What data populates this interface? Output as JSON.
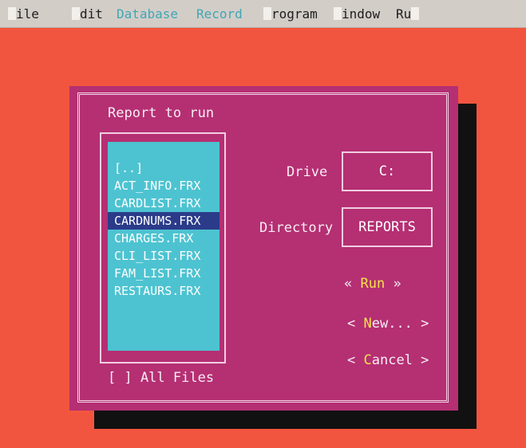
{
  "menubar": {
    "items": [
      {
        "label": "ile",
        "dim": false
      },
      {
        "label": "dit",
        "dim": false
      },
      {
        "label": "Database",
        "dim": true
      },
      {
        "label": "Record",
        "dim": true
      },
      {
        "label": "rogram",
        "dim": false
      },
      {
        "label": "indow",
        "dim": false
      },
      {
        "label": "Ru",
        "dim": false
      }
    ]
  },
  "dialog": {
    "title": "Report to run",
    "files": [
      "[..]",
      "ACT_INFO.FRX",
      "CARDLIST.FRX",
      "CARDNUMS.FRX",
      "CHARGES.FRX",
      "CLI_LIST.FRX",
      "FAM_LIST.FRX",
      "RESTAURS.FRX"
    ],
    "selected_file": "CARDNUMS.FRX",
    "all_files_label": "[ ] All Files",
    "drive_label": "Drive",
    "drive_value": "C:",
    "directory_label": "Directory",
    "directory_value": "REPORTS",
    "run_button": {
      "prefix": "« ",
      "hot": "R",
      "rest": "un",
      "suffix": " »"
    },
    "new_button": {
      "prefix": "< ",
      "hot": "N",
      "rest": "ew...",
      "suffix": " >"
    },
    "cancel_button": {
      "prefix": "< ",
      "hot": "C",
      "rest": "ancel",
      "suffix": " >"
    }
  }
}
